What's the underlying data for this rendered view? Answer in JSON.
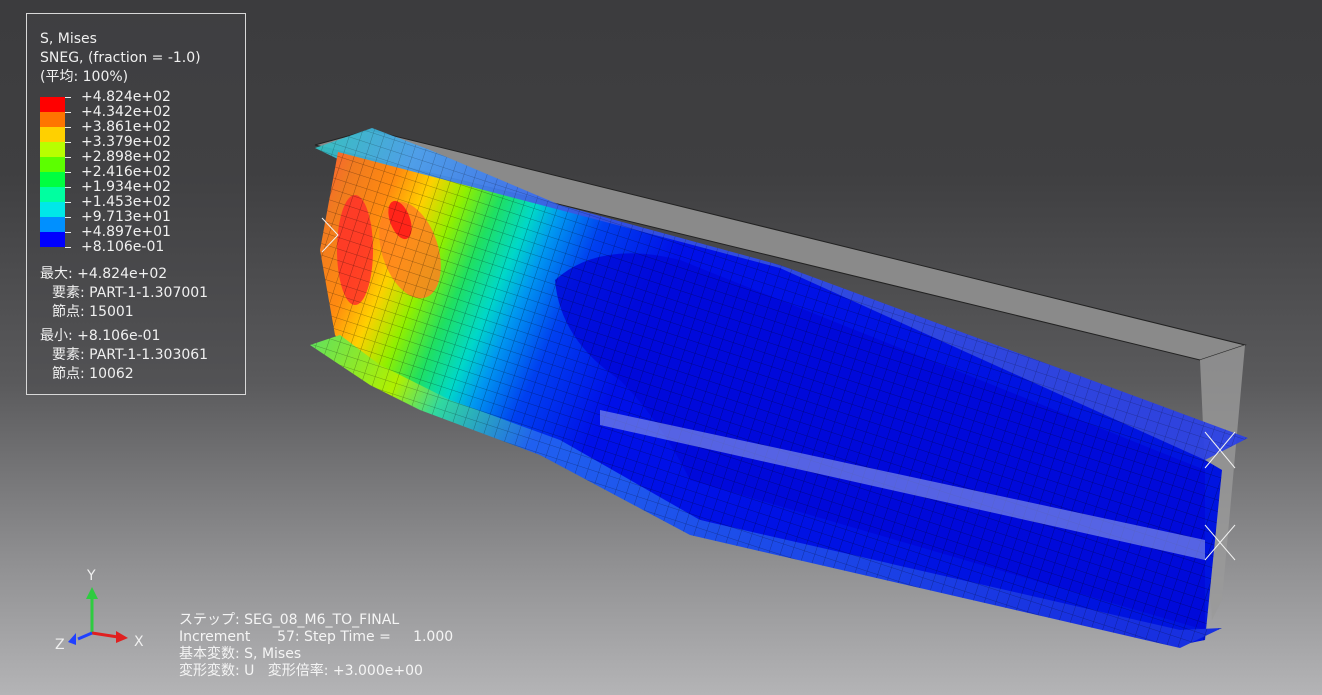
{
  "legend": {
    "title": "S, Mises",
    "sneg": "SNEG, (fraction = -1.0)",
    "average": "(平均: 100%)",
    "levels": [
      {
        "label": "+4.824e+02",
        "color": "#ff0000"
      },
      {
        "label": "+4.342e+02",
        "color": "#ff7400"
      },
      {
        "label": "+3.861e+02",
        "color": "#ffd000"
      },
      {
        "label": "+3.379e+02",
        "color": "#b8ff00"
      },
      {
        "label": "+2.898e+02",
        "color": "#5cff00"
      },
      {
        "label": "+2.416e+02",
        "color": "#00ff40"
      },
      {
        "label": "+1.934e+02",
        "color": "#00ffa0"
      },
      {
        "label": "+1.453e+02",
        "color": "#00e8e8"
      },
      {
        "label": "+9.713e+01",
        "color": "#0090ff"
      },
      {
        "label": "+4.897e+01",
        "color": "#0038ff"
      },
      {
        "label": "+8.106e-01",
        "color": "#0000ff"
      }
    ],
    "max_label": "最大: +4.824e+02",
    "max_element": "要素: PART-1-1.307001",
    "max_node": "節点: 15001",
    "min_label": "最小: +8.106e-01",
    "min_element": "要素: PART-1-1.303061",
    "min_node": "節点: 10062"
  },
  "status": {
    "step": "ステップ: SEG_08_M6_TO_FINAL",
    "increment": "Increment      57: Step Time =     1.000",
    "primary_var": "基本変数: S, Mises",
    "deformed_var": "変形変数: U   変形倍率: +3.000e+00"
  },
  "triad": {
    "x": "X",
    "y": "Y",
    "z": "Z"
  }
}
